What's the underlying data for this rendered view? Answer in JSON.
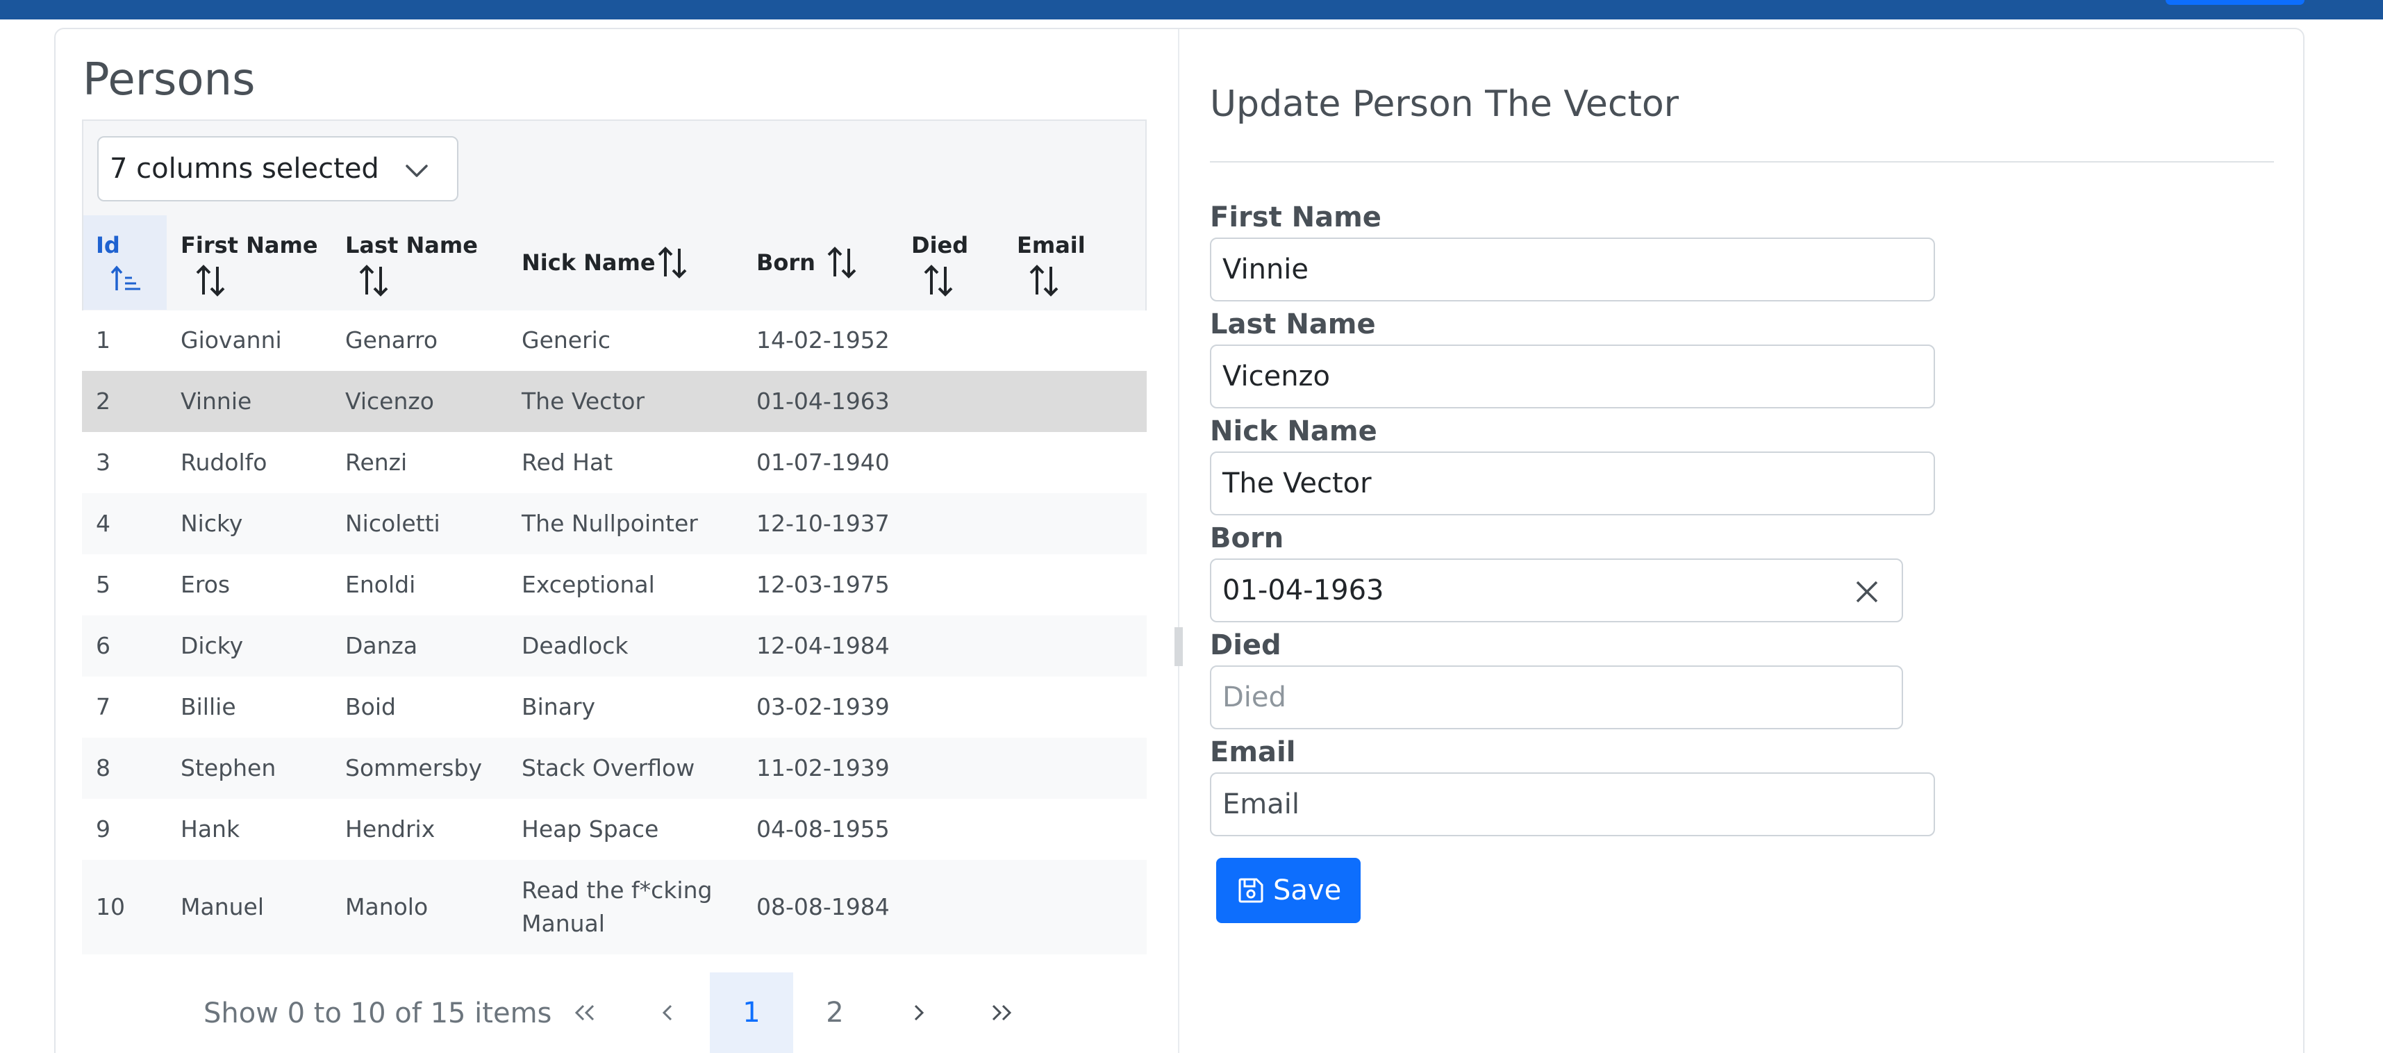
{
  "left": {
    "title": "Persons",
    "column_select": "7 columns selected",
    "columns": [
      "Id",
      "First Name",
      "Last Name",
      "Nick Name",
      "Born",
      "Died",
      "Email"
    ],
    "rows": [
      [
        "1",
        "Giovanni",
        "Genarro",
        "Generic",
        "14-02-1952",
        "",
        ""
      ],
      [
        "2",
        "Vinnie",
        "Vicenzo",
        "The Vector",
        "01-04-1963",
        "",
        ""
      ],
      [
        "3",
        "Rudolfo",
        "Renzi",
        "Red Hat",
        "01-07-1940",
        "",
        ""
      ],
      [
        "4",
        "Nicky",
        "Nicoletti",
        "The Nullpointer",
        "12-10-1937",
        "",
        ""
      ],
      [
        "5",
        "Eros",
        "Enoldi",
        "Exceptional",
        "12-03-1975",
        "",
        ""
      ],
      [
        "6",
        "Dicky",
        "Danza",
        "Deadlock",
        "12-04-1984",
        "",
        ""
      ],
      [
        "7",
        "Billie",
        "Boid",
        "Binary",
        "03-02-1939",
        "",
        ""
      ],
      [
        "8",
        "Stephen",
        "Sommersby",
        "Stack Overflow",
        "11-02-1939",
        "",
        ""
      ],
      [
        "9",
        "Hank",
        "Hendrix",
        "Heap Space",
        "04-08-1955",
        "",
        ""
      ],
      [
        "10",
        "Manuel",
        "Manolo",
        "Read the f*cking Manual",
        "08-08-1984",
        "",
        ""
      ]
    ],
    "nick_line1": "Read the f*cking",
    "nick_line2": "Manual",
    "pager": {
      "summary": "Show 0 to 10 of 15 items",
      "first": "<<",
      "prev": "<",
      "page1": "1",
      "page2": "2",
      "next": ">",
      "last": ">>"
    }
  },
  "right": {
    "title": "Update Person The Vector",
    "fields": {
      "first_name": {
        "label": "First Name",
        "value": "Vinnie"
      },
      "last_name": {
        "label": "Last Name",
        "value": "Vicenzo"
      },
      "nick_name": {
        "label": "Nick Name",
        "value": "The Vector"
      },
      "born": {
        "label": "Born",
        "value": "01-04-1963"
      },
      "died": {
        "label": "Died",
        "placeholder": "Died"
      },
      "email": {
        "label": "Email",
        "placeholder": "Email"
      }
    },
    "save_label": "Save"
  },
  "colors": {
    "topbar": "#1b569c",
    "primary": "#0d6efd",
    "selected_row": "#dcdcdc"
  }
}
